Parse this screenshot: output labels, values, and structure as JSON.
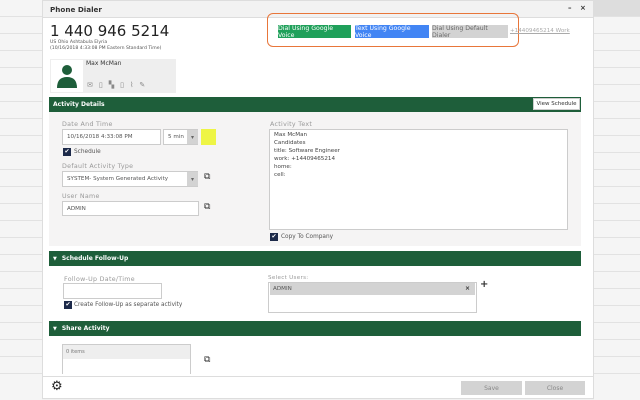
{
  "dialog": {
    "title": "Phone Dialer",
    "minimize_label": "–",
    "close_label": "×"
  },
  "header": {
    "phone": "1 440 946 5214",
    "location": "US Ohio Ashtabula Elyria",
    "local_time": "(10/16/2018 4:33:08 PM Eastern Standard Time)"
  },
  "dial_buttons": {
    "google_dial": "Dial Using Google Voice",
    "google_text": "Text Using Google Voice",
    "default_dial": "Dial Using Default Dialer",
    "work_link": "+14409465214 Work"
  },
  "contact": {
    "name": "Max McMan",
    "icons": [
      "mail-icon",
      "note-icon",
      "chat-icon",
      "document-icon",
      "attachment-icon",
      "edit-icon"
    ]
  },
  "activity": {
    "title": "Activity Details",
    "view_schedule": "View Schedule",
    "date_label": "Date And Time",
    "date_value": "10/16/2018 4:33:08 PM",
    "duration": "5 min",
    "schedule_label": "Schedule",
    "type_label": "Default Activity Type",
    "type_value": "SYSTEM- System Generated Activity",
    "user_label": "User Name",
    "user_value": "ADMIN",
    "text_label": "Activity Text",
    "text_value": "Max McMan\nCandidates\ntitle: Software Engineer\nwork: +14409465214\nhome:\ncell:",
    "copy_label": "Copy To Company"
  },
  "followup": {
    "title": "Schedule Follow-Up",
    "date_label": "Follow-Up Date/Time",
    "date_value": "",
    "separate_label": "Create Follow-Up as separate activity",
    "users_label": "Select Users:",
    "selected_user": "ADMIN",
    "remove": "×",
    "add": "+"
  },
  "share": {
    "title": "Share Activity",
    "items": "0 items"
  },
  "footer": {
    "save": "Save",
    "close": "Close"
  },
  "colors": {
    "green": "#1e5e3a",
    "google_green": "#1fa05a",
    "google_blue": "#4285f4",
    "highlight": "#e8763a",
    "swatch": "#eef545"
  }
}
